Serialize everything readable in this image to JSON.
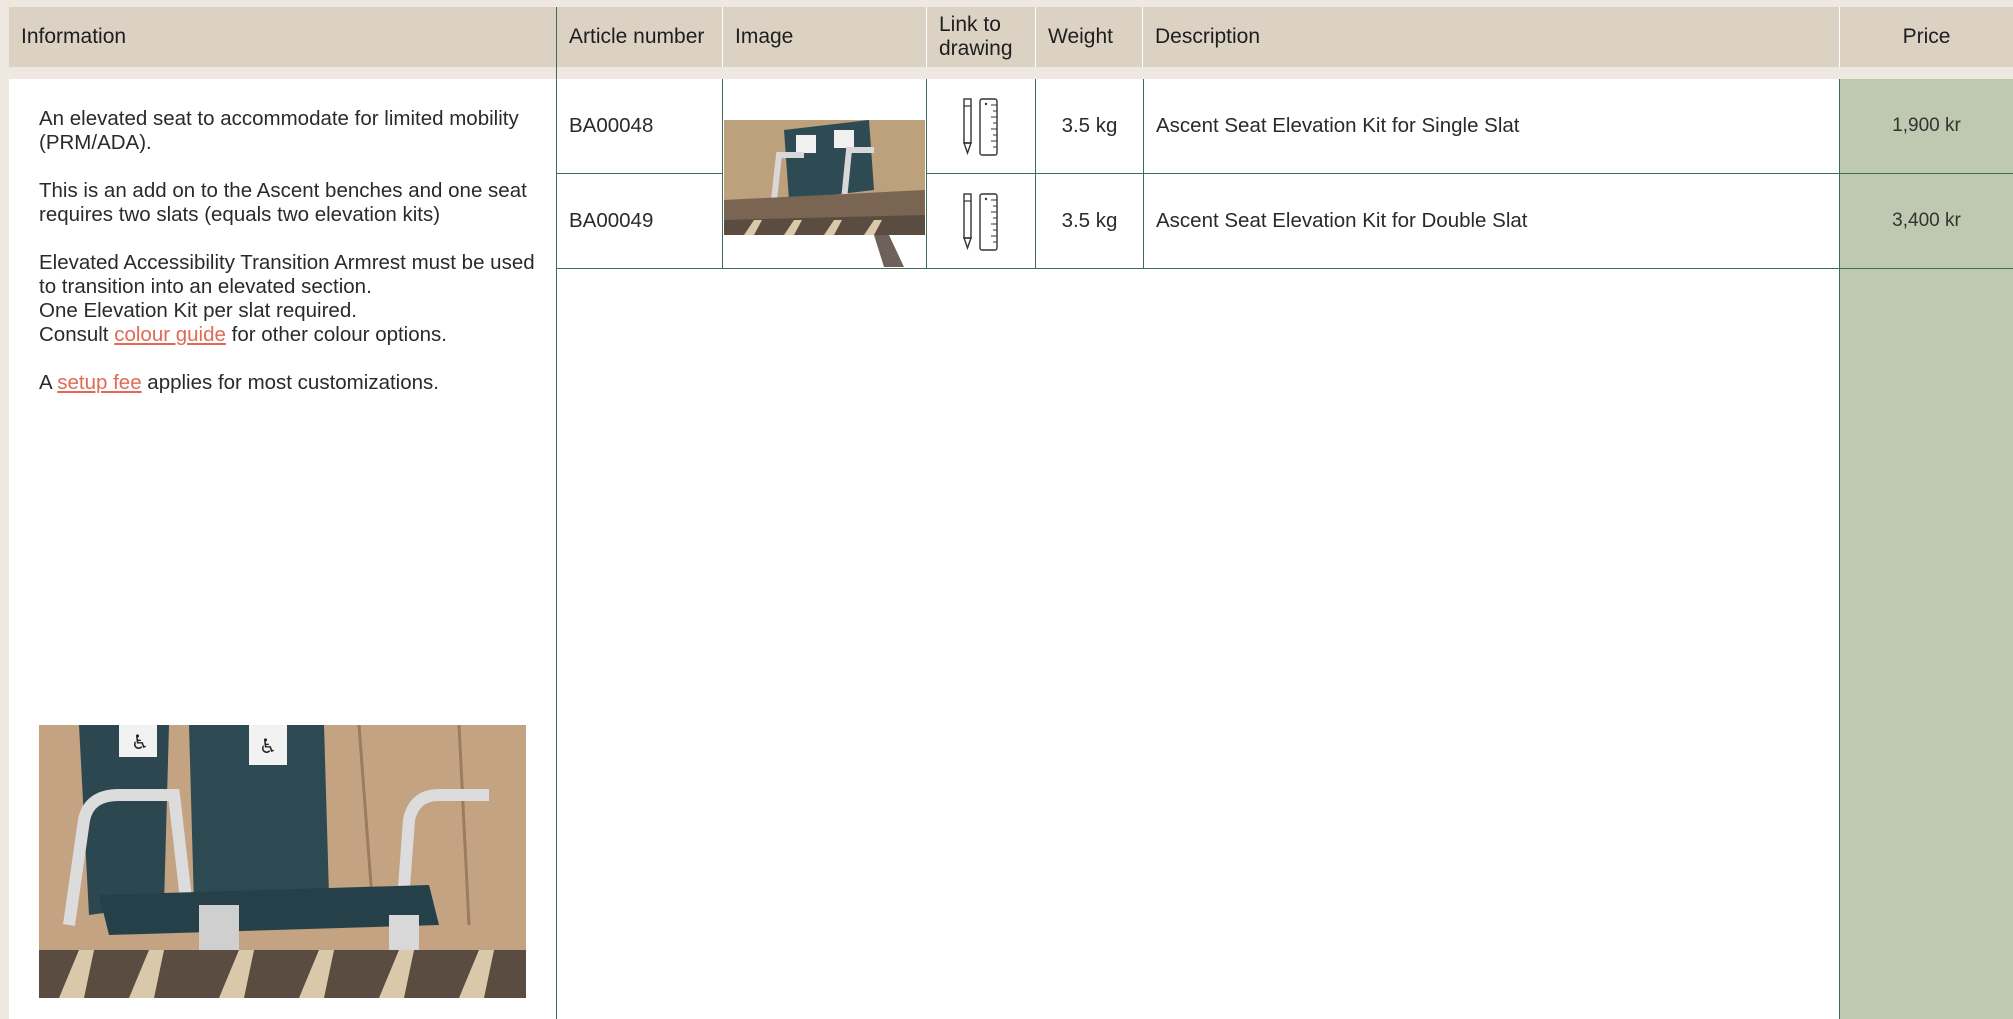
{
  "table": {
    "headers": {
      "information": "Information",
      "article_number": "Article number",
      "image": "Image",
      "link_to_drawing": "Link to drawing",
      "weight": "Weight",
      "description": "Description",
      "price": "Price"
    },
    "rows": [
      {
        "article_number": "BA00048",
        "weight": "3.5 kg",
        "description": "Ascent Seat Elevation Kit for Single Slat",
        "price": "1,900 kr",
        "drawing_icon": "pencil-ruler-icon"
      },
      {
        "article_number": "BA00049",
        "weight": "3.5 kg",
        "description": "Ascent Seat Elevation Kit for Double Slat",
        "price": "3,400 kr",
        "drawing_icon": "pencil-ruler-icon"
      }
    ]
  },
  "information": {
    "para1": "An elevated seat to accommodate for limited mobility (PRM/ADA).",
    "para2": "This is an add on to the Ascent benches and one seat requires two slats (equals two elevation kits)",
    "para3_line1": "Elevated Accessibility Transition Armrest must be used to transition into an elevated section.",
    "para3_line2": "One Elevation Kit per slat required.",
    "para3_consult_prefix": "Consult ",
    "para3_link": "colour guide",
    "para3_consult_suffix": " for other colour options.",
    "para4_prefix": "A ",
    "para4_link": "setup fee",
    "para4_suffix": " applies for most customizations."
  },
  "colors": {
    "header_bg": "#dbd2c4",
    "page_bg": "#eee8e0",
    "price_bg": "#bfc8b0",
    "grid_line": "#3f6b5a",
    "link": "#e06a55"
  }
}
